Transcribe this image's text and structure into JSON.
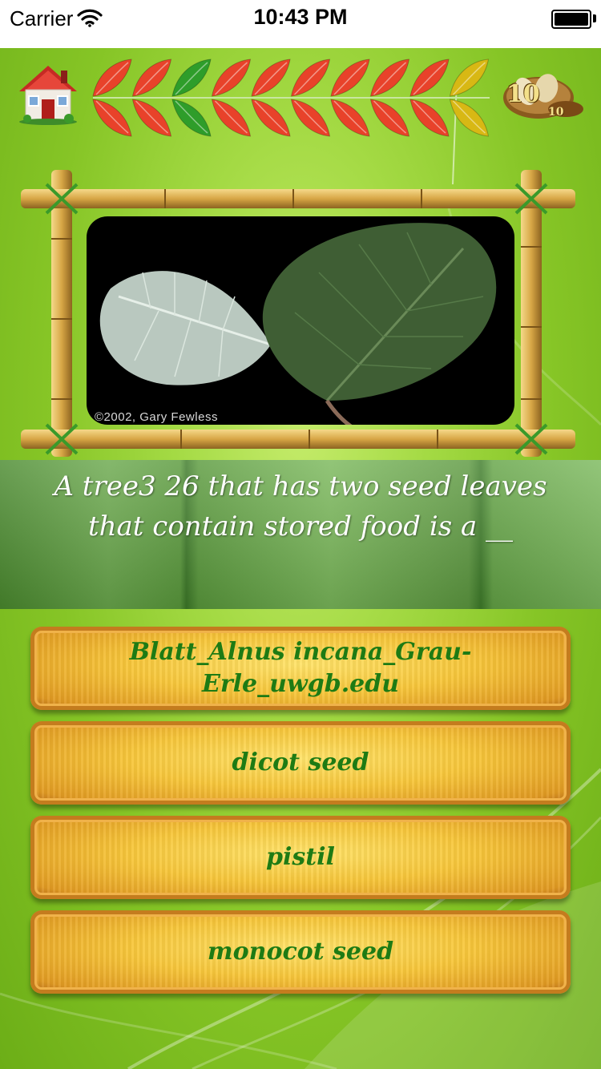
{
  "status_bar": {
    "carrier": "Carrier",
    "time": "10:43 PM"
  },
  "header": {
    "home_icon": "house-icon",
    "progress_leaves": [
      "red",
      "red",
      "green",
      "red",
      "red",
      "red",
      "red",
      "red",
      "red",
      "yellow"
    ],
    "colors": {
      "red": "#e8422a",
      "green": "#2e9d2a",
      "yellow": "#d8b814"
    },
    "coin_icon": "seed-coin-icon",
    "score": "10",
    "total": "10"
  },
  "photo": {
    "credit": "©2002, Gary Fewless"
  },
  "question": {
    "text": "A tree3 26 that has two seed leaves that contain stored food is a __"
  },
  "answers": [
    {
      "label": "Blatt_Alnus incana_Grau-Erle_uwgb.edu"
    },
    {
      "label": "dicot seed"
    },
    {
      "label": "pistil"
    },
    {
      "label": "monocot seed"
    }
  ]
}
